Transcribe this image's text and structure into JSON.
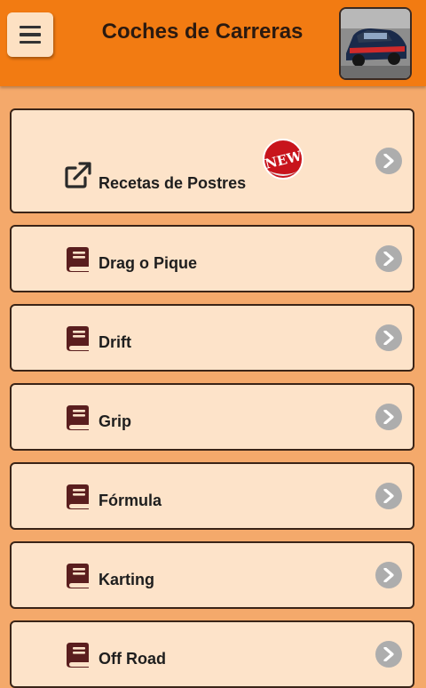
{
  "header": {
    "title": "Coches de Carreras",
    "menu_icon": "hamburger-menu-icon",
    "thumbnail": "rally-car-image"
  },
  "colors": {
    "header_bg": "#f27b12",
    "page_bg": "#f4a96b",
    "card_bg": "#fde3c9",
    "icon_color": "#5a1e1e",
    "badge_red": "#c8141c"
  },
  "items": [
    {
      "label": "Recetas de Postres",
      "icon": "external-link-icon",
      "badge": "NEW"
    },
    {
      "label": "Drag o Pique",
      "icon": "book-icon"
    },
    {
      "label": "Drift",
      "icon": "book-icon"
    },
    {
      "label": "Grip",
      "icon": "book-icon"
    },
    {
      "label": "Fórmula",
      "icon": "book-icon"
    },
    {
      "label": "Karting",
      "icon": "book-icon"
    },
    {
      "label": "Off Road",
      "icon": "book-icon"
    }
  ]
}
